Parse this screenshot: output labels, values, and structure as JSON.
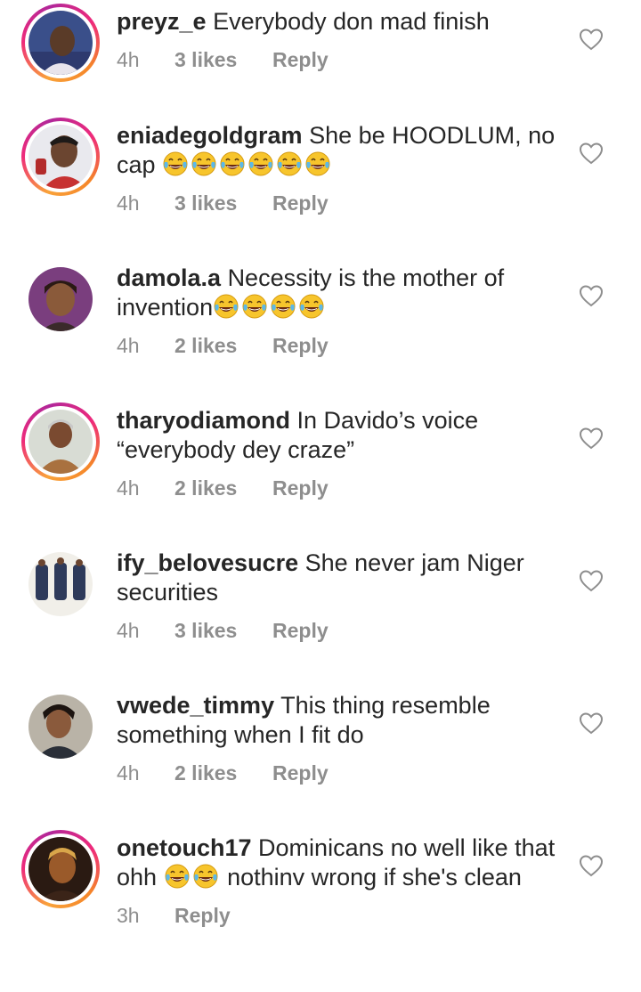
{
  "comments": [
    {
      "username": "preyz_e",
      "text": "Everybody don mad finish",
      "time": "4h",
      "likes": "3 likes",
      "reply": "Reply",
      "emoji_count": 0
    },
    {
      "username": "eniadegoldgram",
      "text": "She be HOODLUM, no cap",
      "time": "4h",
      "likes": "3 likes",
      "reply": "Reply",
      "emoji_count": 6
    },
    {
      "username": "damola.a",
      "text": "Necessity is the mother of invention",
      "time": "4h",
      "likes": "2 likes",
      "reply": "Reply",
      "emoji_count": 4
    },
    {
      "username": "tharyodiamond",
      "text": "In Davido’s voice “everybody dey craze”",
      "time": "4h",
      "likes": "2 likes",
      "reply": "Reply",
      "emoji_count": 0
    },
    {
      "username": "ify_belovesucre",
      "text": "She never jam Niger securities",
      "time": "4h",
      "likes": "3 likes",
      "reply": "Reply",
      "emoji_count": 0
    },
    {
      "username": "vwede_timmy",
      "text": "This thing resemble something when I fit do",
      "time": "4h",
      "likes": "2 likes",
      "reply": "Reply",
      "emoji_count": 0
    },
    {
      "username": "onetouch17",
      "text_before": "Dominicans no well like that ohh",
      "text_after": "nothinv wrong if she's clean",
      "time": "3h",
      "reply": "Reply",
      "emoji_count": 2
    }
  ],
  "icons": {
    "like": "heart-outline-icon",
    "emoji": "face-with-tears-of-joy-icon"
  },
  "colors": {
    "meta_gray": "#8e8e8e",
    "text": "#262626",
    "emoji_yellow": "#f7c52c"
  }
}
